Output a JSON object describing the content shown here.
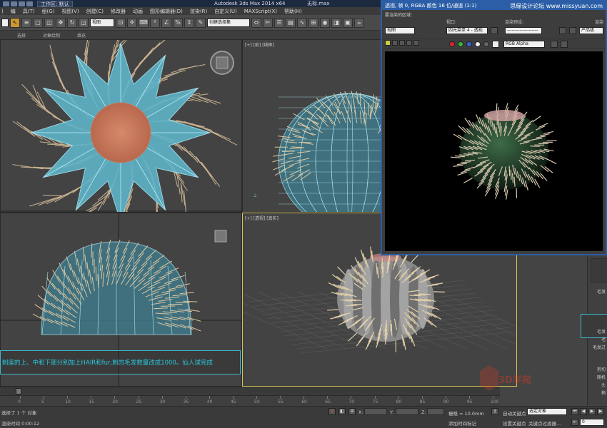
{
  "titlebar": {
    "workspace": "工作区: 默认",
    "app_title": "Autodesk 3ds Max  2014 x64",
    "file_name": "无标.max"
  },
  "menubar": {
    "items": [
      ")",
      "编",
      "具(T)",
      "组(G)",
      "视图(V)",
      "创建(C)",
      "修改器",
      "动画",
      "图形编辑器(D)",
      "渲染(R)",
      "自定义(U)",
      "MAXScript(X)",
      "帮助(H)"
    ]
  },
  "toolbar": {
    "view_select": "视图",
    "named_selection": "创建选择集"
  },
  "ribbon": {
    "labels": [
      "选择",
      "对象绘制",
      "填充"
    ]
  },
  "viewports": {
    "top_right_label": "[+] [前] [线框]",
    "bottom_right_label": "[+] [透视] [真实]"
  },
  "frame_buffer": {
    "title": "透视, 帧 0, RGBA 颜色 16 位/通道 (1:1)",
    "logo": "思缘设计论坛 www.missyuan.com",
    "area_label": "要渲染的区域:",
    "area_value": "视图",
    "viewport_label": "视口:",
    "viewport_value": "四元菜单 4 - 透视",
    "preset_label": "渲染预设:",
    "preset_value": "--------------------",
    "render_label": "渲染",
    "product_value": "产品级",
    "channel_value": "RGB Alpha"
  },
  "caption": {
    "text": "刺座的上、中和下部分别加上HAIR和fur,刺的毛发数量改成1000。仙人球完成"
  },
  "command_panel": {
    "label_1": "毛发",
    "label_2": "毛发",
    "label_3": "毛",
    "label_4": "毛发过",
    "label_5": "剪切",
    "label_6": "随机",
    "label_7": "头",
    "label_8": "梢"
  },
  "timeline": {
    "ticks": [
      "0",
      "5",
      "10",
      "15",
      "20",
      "25",
      "30",
      "35",
      "40",
      "45",
      "50",
      "55",
      "60",
      "65",
      "70",
      "75",
      "80",
      "85",
      "90",
      "95",
      "100"
    ]
  },
  "status": {
    "selection_info": "选择了 1 个 对象",
    "render_time": "渲染时间 0:00:12",
    "x_label": "X:",
    "y_label": "Y:",
    "z_label": "Z:",
    "grid_text": "栅格 = 10.0mm",
    "add_time_tag": "添加时间标记",
    "auto_key": "自动关键点",
    "selected_object": "选定对象",
    "set_key": "设置关键点",
    "key_filter": "关键点过滤器...",
    "frame_value": "0"
  },
  "watermark": {
    "text": "3D学苑"
  },
  "colors": {
    "accent_blue": "#2b5ea6",
    "caption_cyan": "#29c9de",
    "active_yellow": "#d7c35a"
  }
}
